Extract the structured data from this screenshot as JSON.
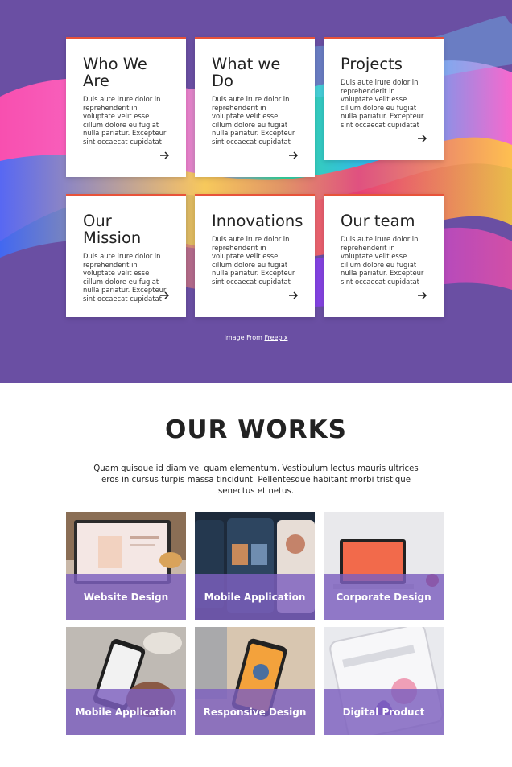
{
  "hero": {
    "cards": [
      {
        "title": "Who We Are",
        "text": "Duis aute irure dolor in reprehenderit in voluptate velit esse cillum dolore eu fugiat nulla pariatur. Excepteur sint occaecat cupidatat"
      },
      {
        "title": "What we Do",
        "text": "Duis aute irure dolor in reprehenderit in voluptate velit esse cillum dolore eu fugiat nulla pariatur. Excepteur sint occaecat cupidatat"
      },
      {
        "title": "Projects",
        "text": "Duis aute irure dolor in reprehenderit in voluptate velit esse cillum dolore eu fugiat nulla pariatur. Excepteur sint occaecat cupidatat"
      },
      {
        "title": "Our Mission",
        "text": "Duis aute irure dolor in reprehenderit in voluptate velit esse cillum dolore eu fugiat nulla pariatur. Excepteur sint occaecat cupidatat"
      },
      {
        "title": "Innovations",
        "text": "Duis aute irure dolor in reprehenderit in voluptate velit esse cillum dolore eu fugiat nulla pariatur. Excepteur sint occaecat cupidatat"
      },
      {
        "title": "Our team",
        "text": "Duis aute irure dolor in reprehenderit in voluptate velit esse cillum dolore eu fugiat nulla pariatur. Excepteur sint occaecat cupidatat"
      }
    ],
    "credit_prefix": "Image From ",
    "credit_link": "Freepix"
  },
  "works": {
    "title": "OUR WORKS",
    "description": "Quam quisque id diam vel quam elementum. Vestibulum lectus mauris ultrices eros in cursus turpis massa tincidunt. Pellentesque habitant morbi tristique senectus et netus.",
    "items": [
      {
        "label": "Website Design"
      },
      {
        "label": "Mobile Application"
      },
      {
        "label": "Corporate Design"
      },
      {
        "label": "Mobile Application"
      },
      {
        "label": "Responsive Design"
      },
      {
        "label": "Digital Product"
      }
    ]
  },
  "colors": {
    "hero_bg": "#6a4fa3",
    "card_accent": "#e8533a",
    "overlay": "#7d5fbe"
  }
}
